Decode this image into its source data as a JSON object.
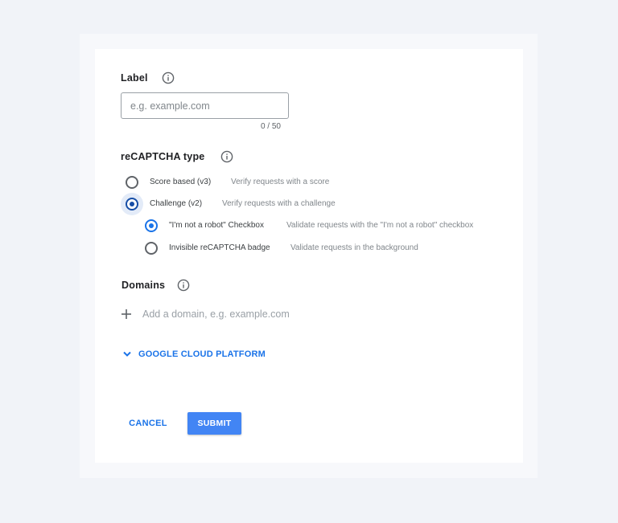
{
  "label_section": {
    "title": "Label",
    "input_placeholder": "e.g. example.com",
    "input_value": "",
    "counter": "0 / 50"
  },
  "recaptcha_section": {
    "title": "reCAPTCHA type",
    "options": [
      {
        "label": "Score based (v3)",
        "description": "Verify requests with a score",
        "selected": false
      },
      {
        "label": "Challenge (v2)",
        "description": "Verify requests with a challenge",
        "selected": true
      }
    ],
    "sub_options": [
      {
        "label": "\"I'm not a robot\" Checkbox",
        "description": "Validate requests with the \"I'm not a robot\" checkbox",
        "selected": true
      },
      {
        "label": "Invisible reCAPTCHA badge",
        "description": "Validate requests in the background",
        "selected": false
      }
    ]
  },
  "domains_section": {
    "title": "Domains",
    "add_placeholder": "Add a domain, e.g. example.com"
  },
  "gcp": {
    "label": "GOOGLE CLOUD PLATFORM",
    "icon": "chevron-down-icon"
  },
  "actions": {
    "cancel_label": "CANCEL",
    "submit_label": "SUBMIT"
  },
  "colors": {
    "accent": "#1a73e8",
    "submit_bg": "#4285f4",
    "page_bg": "#f1f3f8"
  }
}
